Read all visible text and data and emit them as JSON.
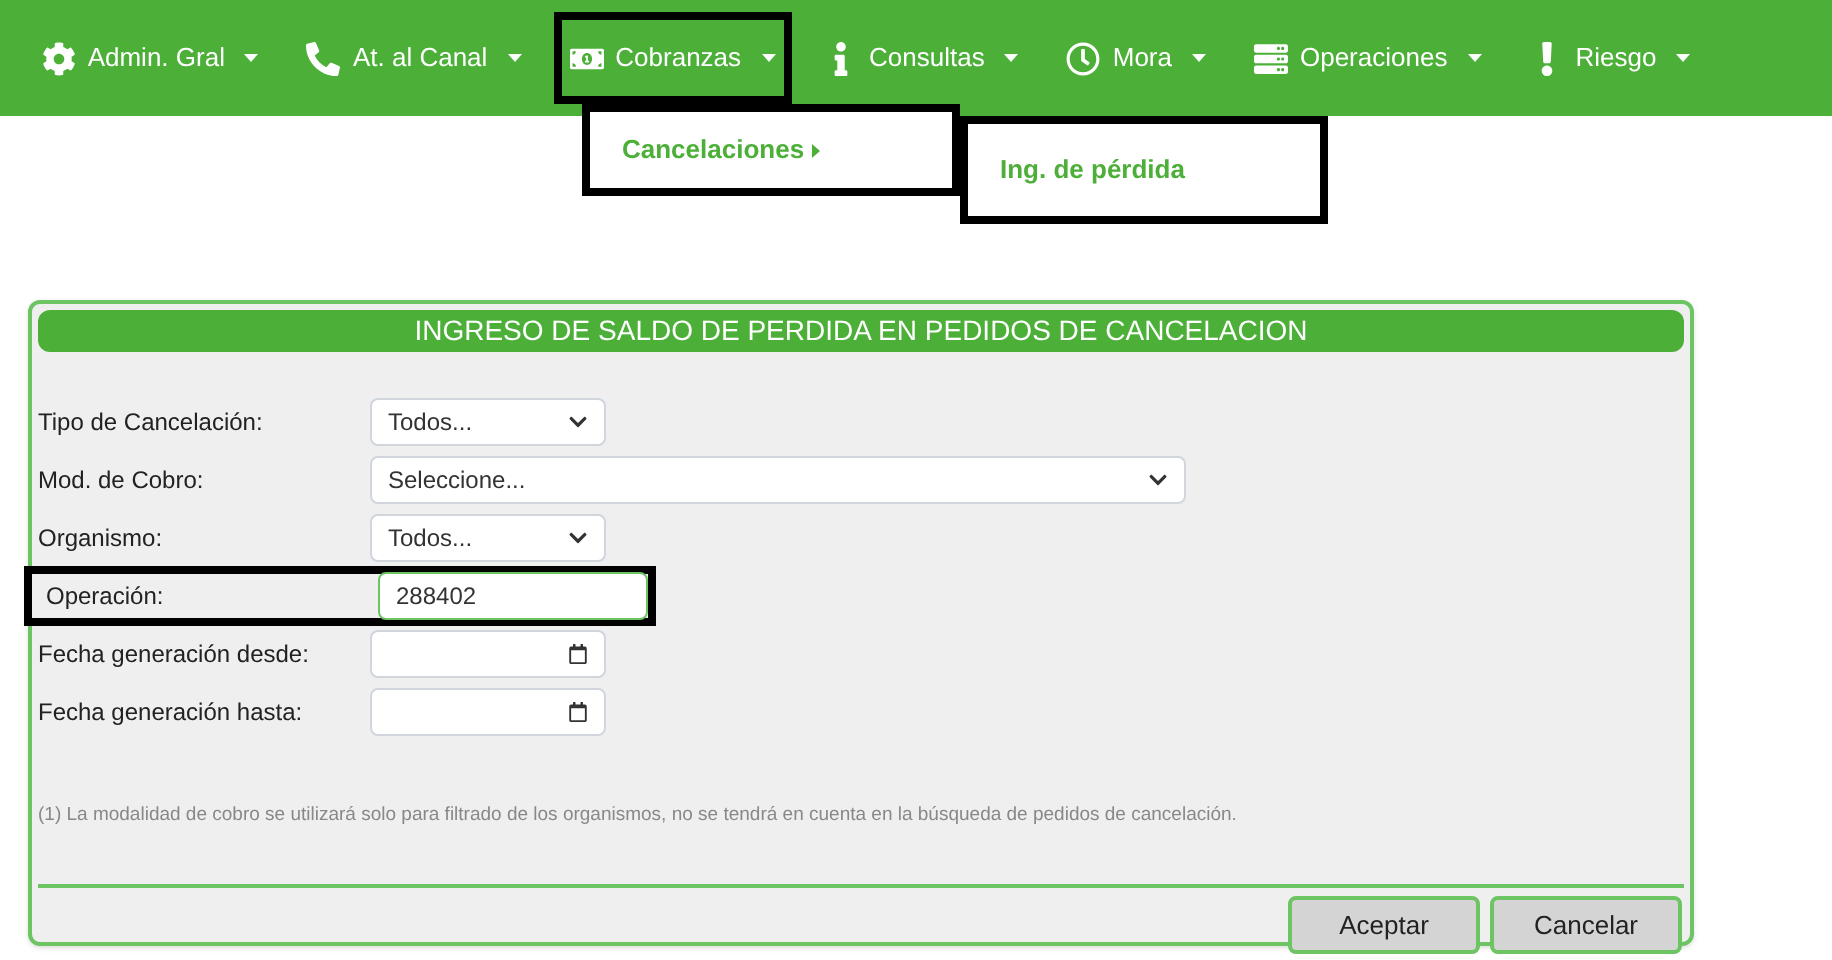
{
  "menu": [
    {
      "label": "Admin. Gral",
      "highlighted": false
    },
    {
      "label": "At. al Canal",
      "highlighted": false
    },
    {
      "label": "Cobranzas",
      "highlighted": true
    },
    {
      "label": "Consultas",
      "highlighted": false
    },
    {
      "label": "Mora",
      "highlighted": false
    },
    {
      "label": "Operaciones",
      "highlighted": false
    },
    {
      "label": "Riesgo",
      "highlighted": false
    }
  ],
  "dropdown": {
    "item": {
      "label": "Cancelaciones",
      "highlighted": true
    },
    "submenu": {
      "label": "Ing. de pérdida",
      "highlighted": true
    }
  },
  "panel": {
    "title": "INGRESO DE SALDO DE PERDIDA EN PEDIDOS DE CANCELACION",
    "fields": [
      {
        "label": "Tipo de Cancelación:",
        "kind": "select",
        "value": "Todos...",
        "highlighted": false
      },
      {
        "label": "Mod. de Cobro:",
        "kind": "wide-select",
        "value": "Seleccione...",
        "highlighted": false
      },
      {
        "label": "Organismo:",
        "kind": "select",
        "value": "Todos...",
        "highlighted": false
      },
      {
        "label": "Operación:",
        "kind": "input",
        "value": "288402",
        "highlighted": true
      },
      {
        "label": "Fecha generación desde:",
        "kind": "date",
        "highlighted": false
      },
      {
        "label": "Fecha generación hasta:",
        "kind": "date",
        "highlighted": false
      }
    ],
    "note": "(1) La modalidad de cobro se utilizará solo para filtrado de los organismos, no se tendrá en cuenta en la búsqueda de pedidos de cancelación.",
    "buttons": [
      "Aceptar",
      "Cancelar"
    ]
  }
}
